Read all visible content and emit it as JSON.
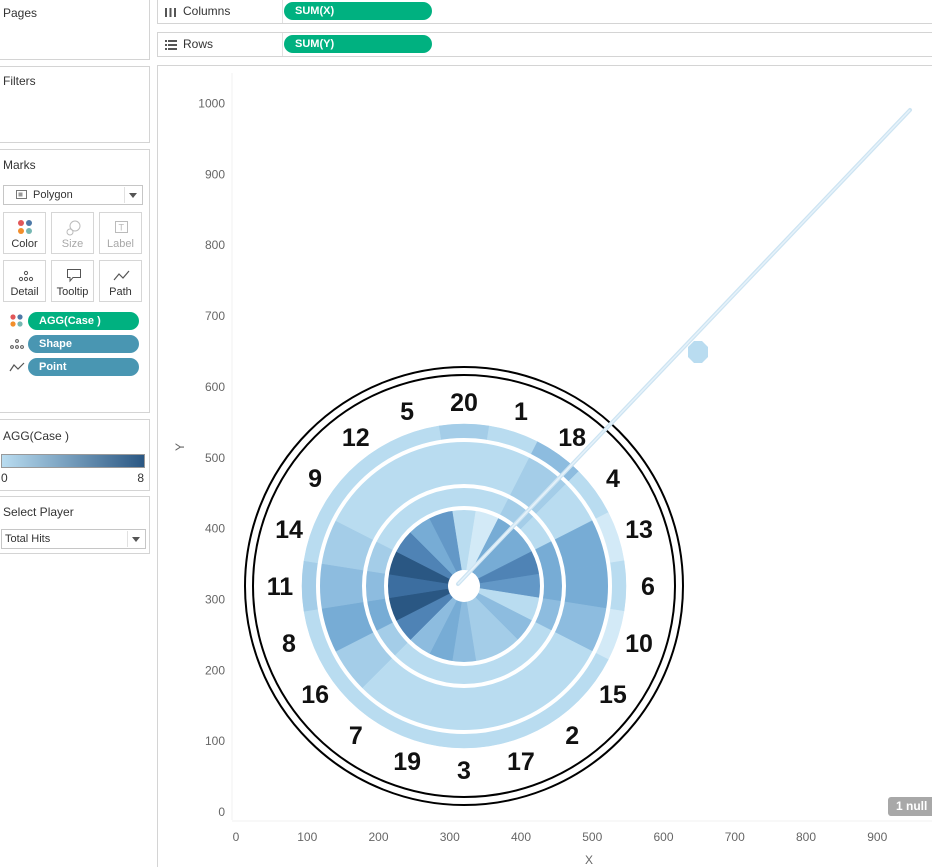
{
  "pages": {
    "title": "Pages"
  },
  "filters": {
    "title": "Filters"
  },
  "marks": {
    "title": "Marks",
    "type": "Polygon",
    "buttons": [
      {
        "name": "color",
        "label": "Color",
        "enabled": true
      },
      {
        "name": "size",
        "label": "Size",
        "enabled": false
      },
      {
        "name": "label",
        "label": "Label",
        "enabled": false
      },
      {
        "name": "detail",
        "label": "Detail",
        "enabled": true
      },
      {
        "name": "tooltip",
        "label": "Tooltip",
        "enabled": true
      },
      {
        "name": "path",
        "label": "Path",
        "enabled": true
      }
    ],
    "fields": [
      {
        "encoding": "color",
        "label": "AGG(Case )",
        "pill": "green"
      },
      {
        "encoding": "detail",
        "label": "Shape",
        "pill": "blue"
      },
      {
        "encoding": "path",
        "label": "Point",
        "pill": "blue"
      }
    ]
  },
  "legend": {
    "title": "AGG(Case )",
    "min": "0",
    "max": "8",
    "color_low": "#b9dcf0",
    "color_high": "#2a5783"
  },
  "parameter": {
    "title": "Select Player",
    "value": "Total Hits"
  },
  "columns": {
    "label": "Columns",
    "pill": "SUM(X)"
  },
  "rows": {
    "label": "Rows",
    "pill": "SUM(Y)"
  },
  "axes": {
    "x_title": "X",
    "y_title": "Y",
    "x_ticks": [
      "0",
      "100",
      "200",
      "300",
      "400",
      "500",
      "600",
      "700",
      "800",
      "900"
    ],
    "y_ticks": [
      "0",
      "100",
      "200",
      "300",
      "400",
      "500",
      "600",
      "700",
      "800",
      "900",
      "1000"
    ]
  },
  "null_indicator": "1 null",
  "dartboard": {
    "numbers": [
      "20",
      "1",
      "18",
      "4",
      "13",
      "6",
      "10",
      "15",
      "2",
      "17",
      "3",
      "19",
      "7",
      "16",
      "8",
      "11",
      "14",
      "9",
      "12",
      "5"
    ],
    "colors": {
      "c0": "#d3eaf7",
      "c1": "#b9dcf0",
      "c2": "#a4cde8",
      "c3": "#8dbcdf",
      "c4": "#77acd5",
      "c5": "#6398c7",
      "c6": "#4f83b5",
      "c7": "#3c6ea0",
      "c8": "#2a5783"
    },
    "outer_ring_levels": [
      2,
      1,
      3,
      1,
      0,
      1,
      0,
      1,
      1,
      1,
      1,
      1,
      1,
      1,
      1,
      2,
      1,
      1,
      1,
      1
    ],
    "middle_ring_levels": [
      1,
      1,
      2,
      1,
      4,
      4,
      3,
      1,
      1,
      1,
      1,
      1,
      1,
      2,
      4,
      3,
      2,
      1,
      1,
      1
    ],
    "inner_ring_levels": [
      1,
      0,
      4,
      4,
      6,
      5,
      1,
      3,
      2,
      2,
      3,
      4,
      3,
      6,
      8,
      7,
      8,
      6,
      4,
      5
    ]
  }
}
